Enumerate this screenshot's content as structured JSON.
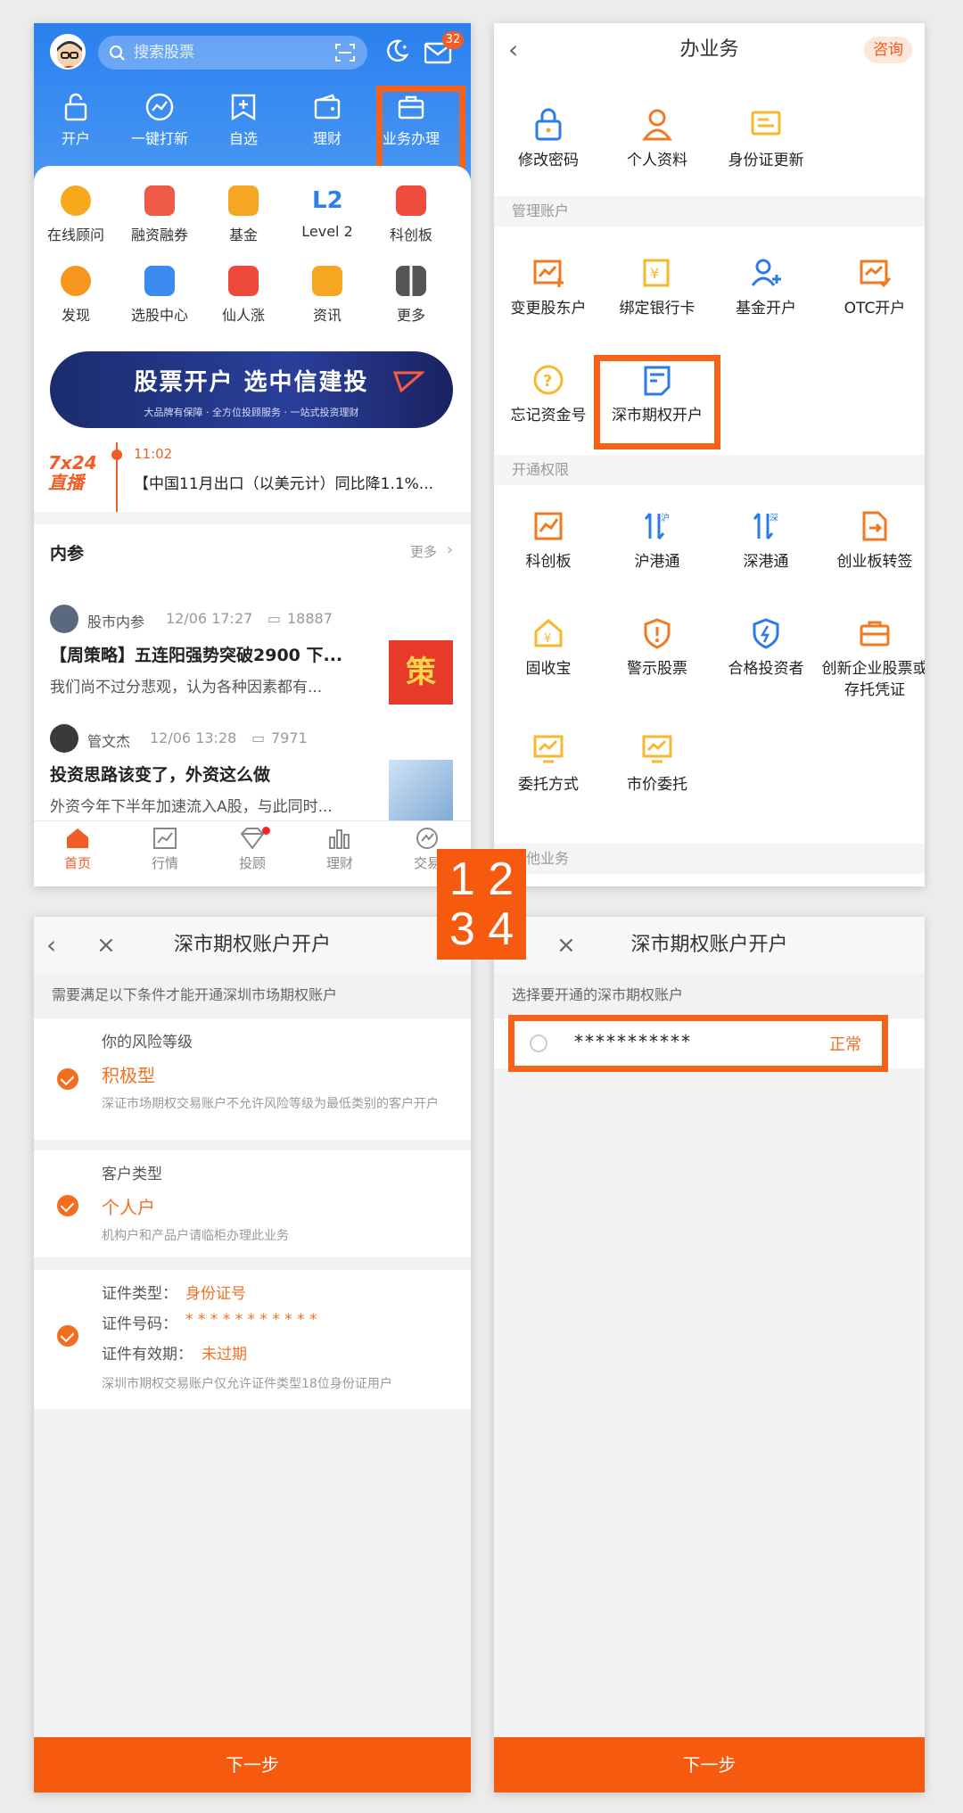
{
  "step_labels": {
    "row1": "1 2",
    "row2": "3 4"
  },
  "colors": {
    "brand_blue": "#2b80ee",
    "highlight_orange": "#f5621a",
    "text_orange": "#f07020"
  },
  "home": {
    "search_placeholder": "搜索股票",
    "message_badge": "32",
    "top_nav": [
      "开户",
      "一键打新",
      "自选",
      "理财",
      "业务办理"
    ],
    "grid": [
      "在线顾问",
      "融资融券",
      "基金",
      "Level 2",
      "科创板",
      "发现",
      "选股中心",
      "仙人涨",
      "资讯",
      "更多"
    ],
    "banner": {
      "title": "股票开户  选中信建投",
      "subtitle": "大品牌有保障 · 全方位投顾服务 · 一站式投资理财"
    },
    "news": {
      "logo": "7x24 直播",
      "time": "11:02",
      "text": "【中国11月出口（以美元计）同比降1.1%..."
    },
    "neican": {
      "title": "内参",
      "more": "更多",
      "articles": [
        {
          "author": "股市内参",
          "time": "12/06 17:27",
          "views": "18887",
          "title": "【周策略】五连阳强势突破2900 下...",
          "summary": "我们尚不过分悲观，认为各种因素都有...",
          "thumb": "策"
        },
        {
          "author": "管文杰",
          "time": "12/06 13:28",
          "views": "7971",
          "title": "投资思路该变了，外资这么做",
          "summary": "外资今年下半年加速流入A股，与此同时..."
        }
      ]
    },
    "tabs": [
      "首页",
      "行情",
      "投顾",
      "理财",
      "交易"
    ]
  },
  "business": {
    "title": "办业务",
    "consult": "咨询",
    "top_items": [
      "修改密码",
      "个人资料",
      "身份证更新"
    ],
    "section_manage": "管理账户",
    "manage_items": [
      "变更股东户",
      "绑定银行卡",
      "基金开户",
      "OTC开户",
      "忘记资金号",
      "深市期权开户"
    ],
    "section_permission": "开通权限",
    "permission_items": [
      "科创板",
      "沪港通",
      "深港通",
      "创业板转签",
      "固收宝",
      "警示股票",
      "合格投资者",
      "创新企业股票或存托凭证",
      "委托方式",
      "市价委托"
    ],
    "section_other": "其他业务"
  },
  "conditions": {
    "title": "深市期权账户开户",
    "intro": "需要满足以下条件才能开通深圳市场期权账户",
    "risk_label": "你的风险等级",
    "risk_value": "积极型",
    "risk_note": "深证市场期权交易账户不允许风险等级为最低类别的客户开户",
    "type_label": "客户类型",
    "type_value": "个人户",
    "type_note": "机构户和产品户请临柜办理此业务",
    "id_type_label": "证件类型：",
    "id_type_value": "身份证号",
    "id_no_label": "证件号码：",
    "id_no_value": "* * * * * * * * * * *",
    "id_valid_label": "证件有效期：",
    "id_valid_value": "未过期",
    "id_note": "深圳市期权交易账户仅允许证件类型18位身份证用户",
    "next": "下一步"
  },
  "select": {
    "title": "深市期权账户开户",
    "intro": "选择要开通的深市期权账户",
    "account": "***********",
    "status": "正常",
    "next": "下一步"
  }
}
